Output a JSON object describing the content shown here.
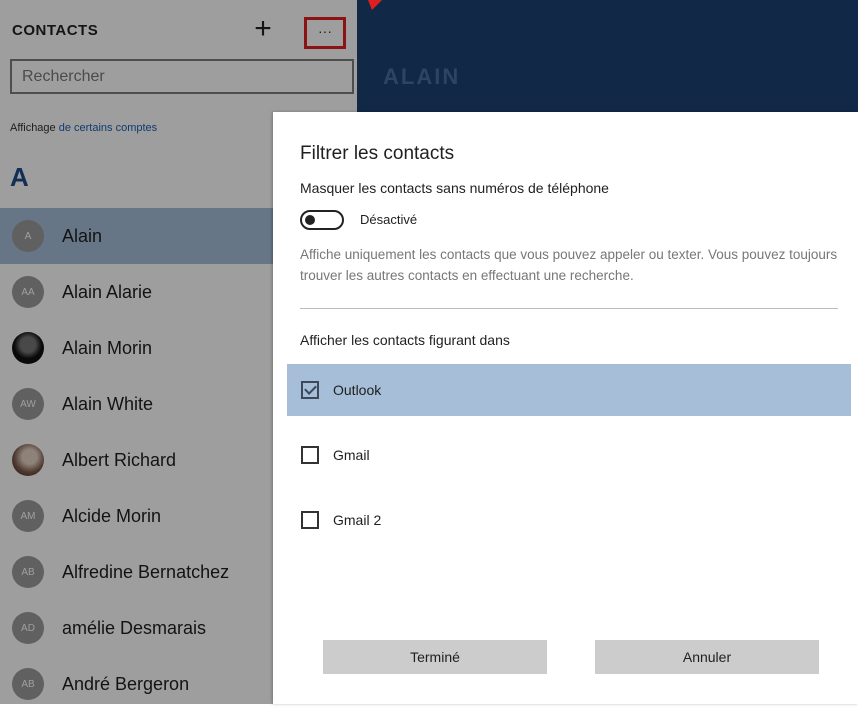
{
  "sidebar": {
    "title": "CONTACTS",
    "add_icon": "plus-icon",
    "more_icon": "more-dots-icon",
    "more_label": "···",
    "search_placeholder": "Rechercher",
    "show_prefix": "Affichage",
    "show_link": "de certains comptes",
    "section_letter": "A",
    "contacts": [
      {
        "initials": "A",
        "name": "Alain",
        "selected": true
      },
      {
        "initials": "AA",
        "name": "Alain Alarie"
      },
      {
        "initials": "",
        "name": "Alain Morin",
        "photo": true
      },
      {
        "initials": "AW",
        "name": "Alain White"
      },
      {
        "initials": "",
        "name": "Albert Richard",
        "photo": true
      },
      {
        "initials": "AM",
        "name": "Alcide Morin"
      },
      {
        "initials": "AB",
        "name": "Alfredine Bernatchez"
      },
      {
        "initials": "AD",
        "name": "amélie Desmarais"
      },
      {
        "initials": "AB",
        "name": "André Bergeron"
      }
    ]
  },
  "header": {
    "contact_name": "ALAIN"
  },
  "dialog": {
    "title": "Filtrer les contacts",
    "hide_label": "Masquer les contacts sans numéros de téléphone",
    "toggle_state": "Désactivé",
    "help_text": "Affiche uniquement les contacts que vous pouvez appeler ou texter. Vous pouvez toujours trouver les autres contacts en effectuant une recherche.",
    "show_in_label": "Afficher les contacts figurant dans",
    "options": [
      {
        "label": "Outlook",
        "checked": true
      },
      {
        "label": "Gmail",
        "checked": false
      },
      {
        "label": "Gmail 2",
        "checked": false
      }
    ],
    "done_label": "Terminé",
    "cancel_label": "Annuler"
  },
  "colors": {
    "header_bg": "#1e4173",
    "selection": "#a6bed8",
    "annotation": "#e02020"
  }
}
